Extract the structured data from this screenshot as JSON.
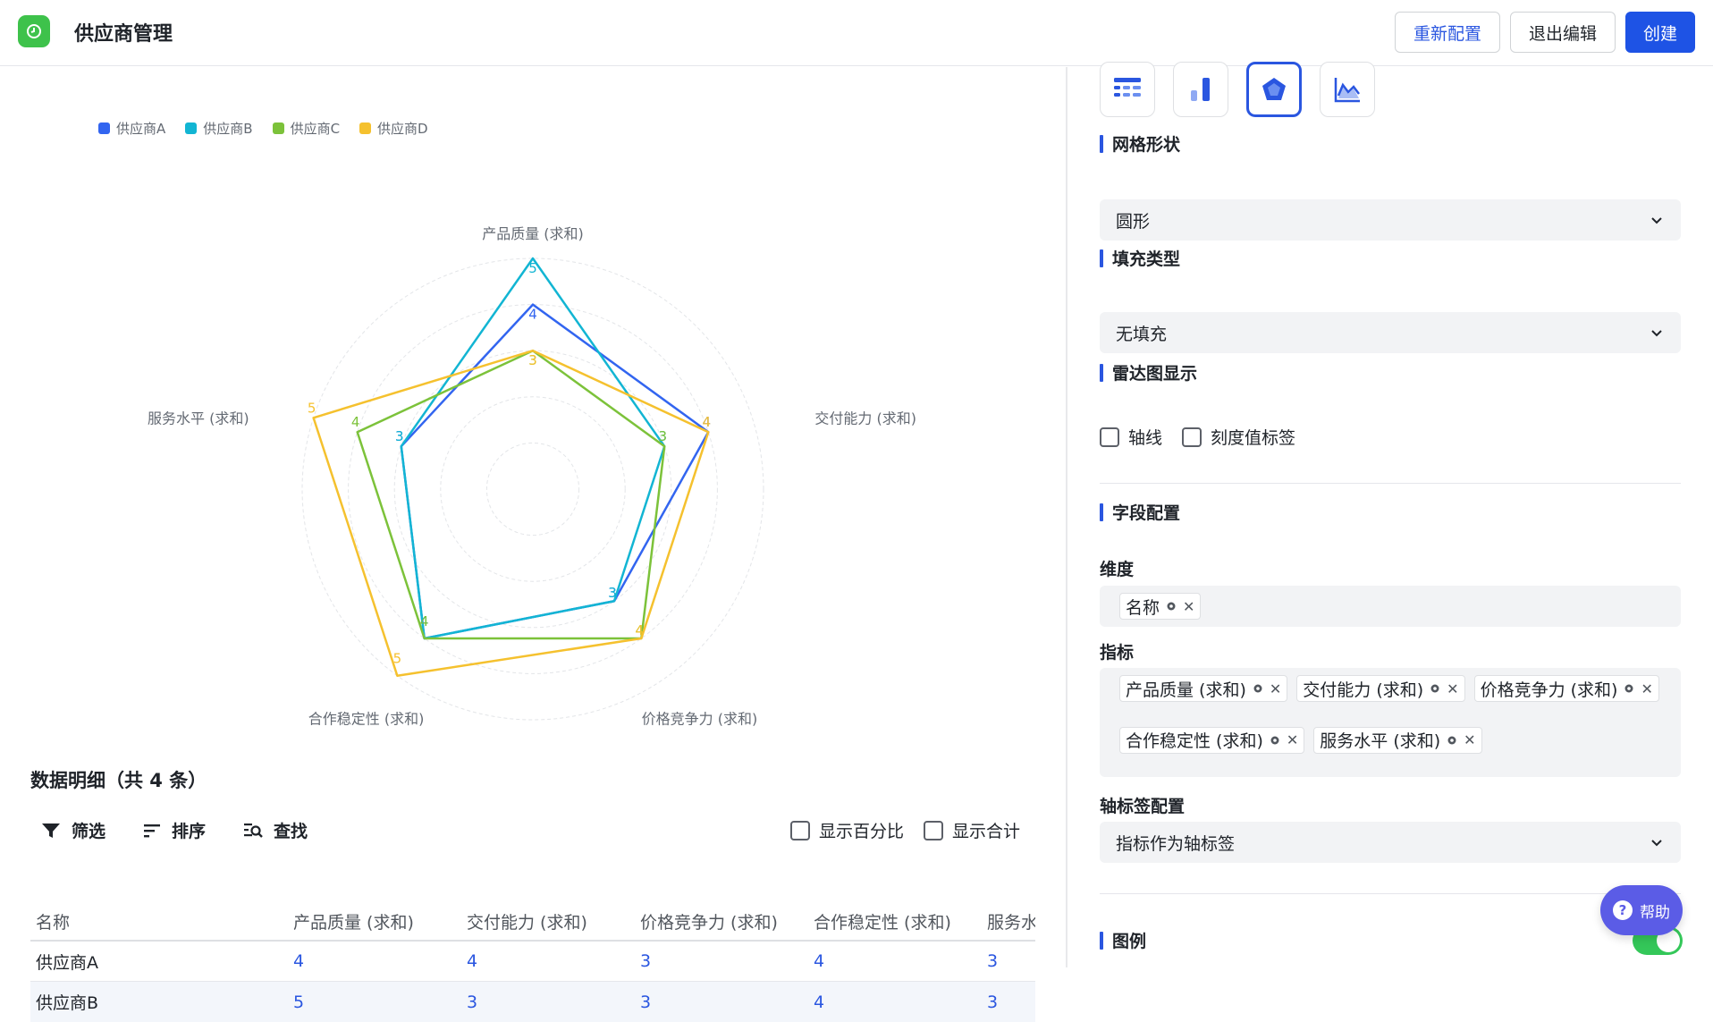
{
  "header": {
    "title": "供应商管理",
    "reconfig_label": "重新配置",
    "exit_label": "退出编辑",
    "create_label": "创建"
  },
  "chart_data": {
    "type": "radar",
    "grid_shape": "circle",
    "max": 5,
    "axes": [
      "产品质量 (求和)",
      "交付能力 (求和)",
      "价格竞争力 (求和)",
      "合作稳定性 (求和)",
      "服务水平 (求和)"
    ],
    "series": [
      {
        "name": "供应商A",
        "color": "#3265f0",
        "values": [
          4,
          4,
          3,
          4,
          3
        ]
      },
      {
        "name": "供应商B",
        "color": "#12b5d3",
        "values": [
          5,
          3,
          3,
          4,
          3
        ]
      },
      {
        "name": "供应商C",
        "color": "#7cc23a",
        "values": [
          3,
          3,
          4,
          4,
          4
        ]
      },
      {
        "name": "供应商D",
        "color": "#f5c12e",
        "values": [
          3,
          4,
          4,
          5,
          5
        ]
      }
    ]
  },
  "detail": {
    "title": "数据明细（共 4 条）",
    "tools": {
      "filter": "筛选",
      "sort": "排序",
      "search": "查找"
    },
    "show_percent": "显示百分比",
    "show_total": "显示合计",
    "columns": [
      "名称",
      "产品质量 (求和)",
      "交付能力 (求和)",
      "价格竞争力 (求和)",
      "合作稳定性 (求和)",
      "服务水平 (求和)"
    ],
    "rows": [
      {
        "name": "供应商A",
        "v1": "4",
        "v2": "4",
        "v3": "3",
        "v4": "4",
        "v5": "3"
      },
      {
        "name": "供应商B",
        "v1": "5",
        "v2": "3",
        "v3": "3",
        "v4": "4",
        "v5": "3"
      }
    ]
  },
  "panel": {
    "grid_shape_label": "网格形状",
    "grid_shape_value": "圆形",
    "fill_type_label": "填充类型",
    "fill_type_value": "无填充",
    "radar_display_label": "雷达图显示",
    "axis_line_label": "轴线",
    "tick_label_label": "刻度值标签",
    "field_config_label": "字段配置",
    "dimension_label": "维度",
    "dimension_tags": [
      "名称"
    ],
    "metric_label": "指标",
    "metric_tags": [
      "产品质量 (求和)",
      "交付能力 (求和)",
      "价格竞争力 (求和)",
      "合作稳定性 (求和)",
      "服务水平 (求和)"
    ],
    "axis_label_config_label": "轴标签配置",
    "axis_label_config_value": "指标作为轴标签",
    "legend_label": "图例"
  },
  "help_label": "帮助"
}
